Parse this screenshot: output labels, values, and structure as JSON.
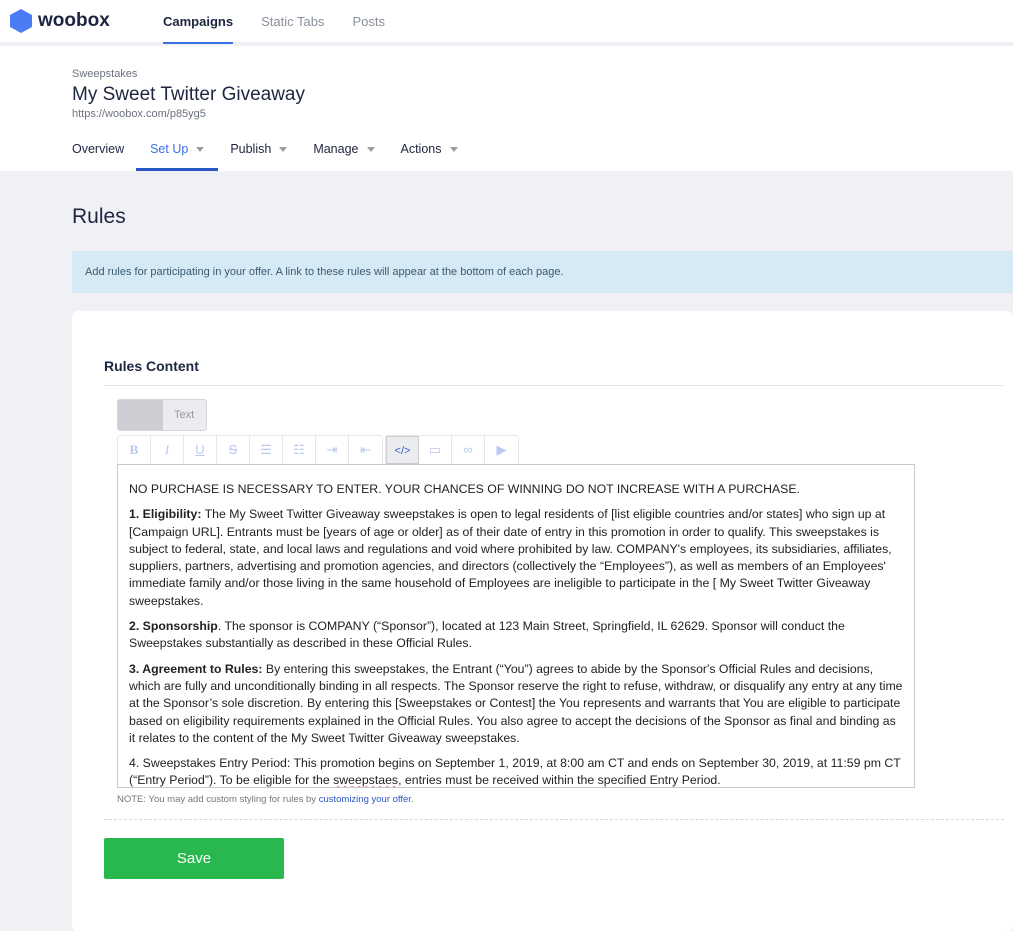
{
  "brand": {
    "name": "woobox",
    "color": "#4a7cf6"
  },
  "topnav": [
    {
      "label": "Campaigns",
      "active": true
    },
    {
      "label": "Static Tabs"
    },
    {
      "label": "Posts"
    }
  ],
  "campaign": {
    "type": "Sweepstakes",
    "title": "My Sweet Twitter Giveaway",
    "url": "https://woobox.com/p85yg5"
  },
  "subnav": [
    {
      "label": "Overview"
    },
    {
      "label": "Set Up",
      "active": true
    },
    {
      "label": "Publish"
    },
    {
      "label": "Manage"
    },
    {
      "label": "Actions"
    }
  ],
  "page": {
    "title": "Rules",
    "alert": "Add rules for participating in your offer. A link to these rules will appear at the bottom of each page."
  },
  "rules": {
    "section_title": "Rules Content",
    "toggle_label": "Text",
    "toolbar": [
      "bold-icon",
      "italic-icon",
      "underline-icon",
      "strikethrough-icon",
      "bullet-list-icon",
      "numbered-list-icon",
      "indent-icon",
      "outdent-icon",
      "code-icon",
      "image-icon",
      "link-icon",
      "video-icon"
    ],
    "p0": "NO PURCHASE IS NECESSARY TO ENTER. YOUR CHANCES OF WINNING DO NOT INCREASE WITH A PURCHASE.",
    "p1_b": "1. Eligibility:",
    "p1": " The My Sweet Twitter Giveaway sweepstakes is open to legal residents of [list eligible countries and/or states] who sign up at [Campaign URL]. Entrants must be [years of age or older] as of their date of entry in this promotion in order to qualify. This sweepstakes is subject to federal, state, and local laws and regulations and void where prohibited by law. COMPANY's employees, its subsidiaries, affiliates, suppliers, partners, advertising and promotion agencies, and directors (collectively the “Employees”), as well as members of an Employees' immediate family and/or those living in the same household of Employees are ineligible to participate in the [ My Sweet Twitter Giveaway sweepstakes.",
    "p2_b": "2. Sponsorship",
    "p2": ". The sponsor is COMPANY (“Sponsor”), located at 123 Main Street, Springfield, IL 62629. Sponsor will conduct the Sweepstakes substantially as described in these Official Rules.",
    "p3_b": "3. Agreement to Rules:",
    "p3": " By entering this sweepstakes, the Entrant (“You”) agrees to abide by the Sponsor's Official Rules and decisions, which are fully and unconditionally binding in all respects. The Sponsor reserve the right to refuse, withdraw, or disqualify any entry at any time at the Sponsor’s sole discretion. By entering this [Sweepstakes or Contest] the You represents and warrants that You are eligible to participate based on eligibility requirements explained in the Official Rules. You also agree to accept the decisions of the Sponsor as final and binding as it relates to the content of the My Sweet Twitter Giveaway sweepstakes.",
    "p4a": "4.  Sweepstakes Entry Period: This promotion begins on September 1, 2019, at 8:00 am CT and ends on September 30, 2019, at 11:59 pm CT (“Entry Period”). To be eligible for the ",
    "p4sp": "sweepstaes",
    "p4b": ", entries must be received within the specified Entry Period.",
    "note": "NOTE: You may add custom styling for rules by ",
    "note_link": "customizing your offer",
    "note_end": ".",
    "save": "Save"
  }
}
